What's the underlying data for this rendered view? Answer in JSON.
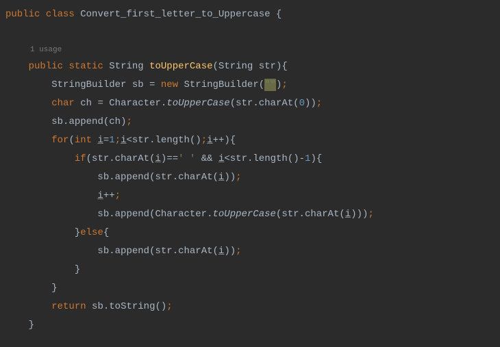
{
  "code": {
    "line1": {
      "public": "public",
      "class": "class",
      "classname": "Convert_first_letter_to_Uppercase",
      "brace": " {"
    },
    "usage_hint": "1 usage",
    "line2": {
      "public": "public",
      "static": "static",
      "rettype": "String",
      "method": "toUpperCase",
      "paramtype": "String",
      "paramname": "str",
      "paren_open": "(",
      "paren_close": "){"
    },
    "line3": {
      "type": "StringBuilder",
      "var": "sb",
      "eq": " = ",
      "new": "new",
      "ctor": "StringBuilder",
      "paren_open": "(",
      "arg": "\"\"",
      "paren_close": ")",
      "semi": ";"
    },
    "line4": {
      "char": "char",
      "var": "ch",
      "eq": " = ",
      "class": "Character",
      "dot": ".",
      "method": "toUpperCase",
      "paren_open1": "(",
      "str": "str",
      "dot2": ".",
      "charAt": "charAt",
      "paren_open2": "(",
      "zero": "0",
      "close": "))",
      "semi": ";"
    },
    "line5": {
      "sb": "sb",
      "dot": ".",
      "append": "append",
      "paren_open": "(",
      "ch": "ch",
      "paren_close": ")",
      "semi": ";"
    },
    "line6": {
      "for": "for",
      "paren_open": "(",
      "int": "int",
      "sp": " ",
      "i1": "i",
      "eq": "=",
      "one": "1",
      "semi1": ";",
      "i2": "i",
      "lt": "<",
      "str": "str",
      "dot": ".",
      "length": "length",
      "parens": "()",
      "semi2": ";",
      "i3": "i",
      "incr": "++",
      "close": "){"
    },
    "line7": {
      "if": "if",
      "paren_open": "(",
      "str1": "str",
      "dot1": ".",
      "charAt1": "charAt",
      "po1": "(",
      "i1": "i",
      "pc1": ")",
      "eqeq": "==",
      "space_char": "' '",
      "and": " && ",
      "i2": "i",
      "lt": "<",
      "str2": "str",
      "dot2": ".",
      "length": "length",
      "parens": "()",
      "minus": "-",
      "one": "1",
      "close": "){"
    },
    "line8": {
      "sb": "sb",
      "dot": ".",
      "append": "append",
      "po": "(",
      "str": "str",
      "dot2": ".",
      "charAt": "charAt",
      "po2": "(",
      "i": "i",
      "close": "))",
      "semi": ";"
    },
    "line9": {
      "i": "i",
      "incr": "++",
      "semi": ";"
    },
    "line10": {
      "sb": "sb",
      "dot": ".",
      "append": "append",
      "po": "(",
      "charclass": "Character",
      "dot2": ".",
      "touc": "toUpperCase",
      "po2": "(",
      "str": "str",
      "dot3": ".",
      "charAt": "charAt",
      "po3": "(",
      "i": "i",
      "close": ")))",
      "semi": ";"
    },
    "line11": {
      "close": "}",
      "else": "else",
      "open": "{"
    },
    "line12": {
      "sb": "sb",
      "dot": ".",
      "append": "append",
      "po": "(",
      "str": "str",
      "dot2": ".",
      "charAt": "charAt",
      "po2": "(",
      "i": "i",
      "close": "))",
      "semi": ";"
    },
    "line13": {
      "close": "}"
    },
    "line14": {
      "close": "}"
    },
    "line15": {
      "return": "return",
      "sp": " ",
      "sb": "sb",
      "dot": ".",
      "tostr": "toString",
      "parens": "()",
      "semi": ";"
    },
    "line16": {
      "close": "}"
    }
  }
}
